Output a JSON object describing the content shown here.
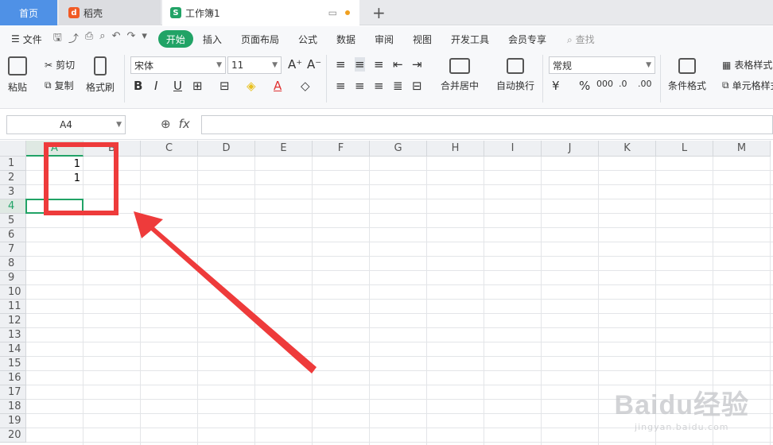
{
  "tabs": {
    "home": "首页",
    "docer": "稻壳",
    "workbook": "工作簿1"
  },
  "menu": {
    "file": "文件",
    "tabs": [
      "开始",
      "插入",
      "页面布局",
      "公式",
      "数据",
      "审阅",
      "视图",
      "开发工具",
      "会员专享"
    ],
    "active_tab": "开始",
    "search": "查找"
  },
  "ribbon": {
    "paste": "粘贴",
    "cut": "剪切",
    "copy": "复制",
    "format_painter": "格式刷",
    "font_name": "宋体",
    "font_size": "11",
    "merge_center": "合并居中",
    "wrap_text": "自动换行",
    "number_format": "常规",
    "conditional_format": "条件格式",
    "table_style": "表格样式",
    "cell_style": "单元格样式"
  },
  "formula_bar": {
    "name_box": "A4",
    "fx": "fx",
    "content": ""
  },
  "grid": {
    "columns": [
      "A",
      "B",
      "C",
      "D",
      "E",
      "F",
      "G",
      "H",
      "I",
      "J",
      "K",
      "L",
      "M"
    ],
    "rows": [
      "1",
      "2",
      "3",
      "4",
      "5",
      "6",
      "7",
      "8",
      "9",
      "10",
      "11",
      "12",
      "13",
      "14",
      "15",
      "16",
      "17",
      "18",
      "19",
      "20"
    ],
    "active_column": "A",
    "active_row": "4",
    "cells": {
      "A1": "1",
      "A2": "1"
    }
  },
  "watermark": {
    "main": "Baidu经验",
    "sub": "jingyan.baidu.com"
  },
  "colors": {
    "accent": "#21a366",
    "annotation": "#ee3b3b"
  }
}
